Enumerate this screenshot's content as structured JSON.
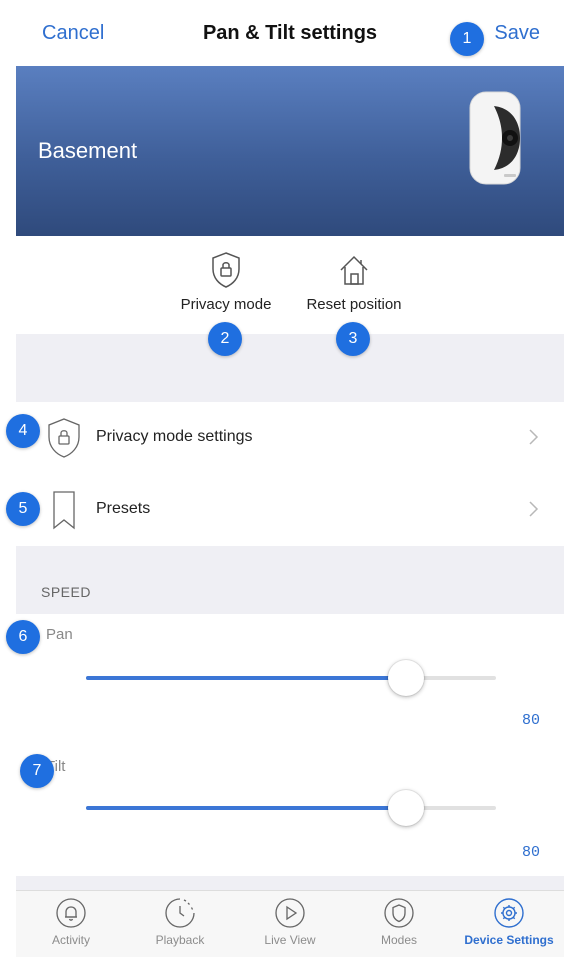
{
  "nav": {
    "cancel": "Cancel",
    "title": "Pan & Tilt settings",
    "save": "Save"
  },
  "banner": {
    "device_name": "Basement"
  },
  "actions": [
    {
      "label": "Privacy mode",
      "icon": "shield-lock-icon"
    },
    {
      "label": "Reset position",
      "icon": "home-icon"
    }
  ],
  "list": [
    {
      "label": "Privacy mode settings",
      "icon": "shield-lock-icon"
    },
    {
      "label": "Presets",
      "icon": "bookmark-icon"
    }
  ],
  "speed": {
    "header": "SPEED",
    "pan": {
      "label": "Pan",
      "value": "80",
      "level_percent": 78
    },
    "tilt": {
      "label": "Tilt",
      "value": "80",
      "level_percent": 78
    }
  },
  "tabs": [
    {
      "label": "Activity",
      "icon": "bell-icon",
      "active": false
    },
    {
      "label": "Playback",
      "icon": "clock-icon",
      "active": false
    },
    {
      "label": "Live View",
      "icon": "play-icon",
      "active": false
    },
    {
      "label": "Modes",
      "icon": "shield-icon",
      "active": false
    },
    {
      "label": "Device Settings",
      "icon": "gear-icon",
      "active": true
    }
  ],
  "callouts": [
    "1",
    "2",
    "3",
    "4",
    "5",
    "6",
    "7"
  ],
  "colors": {
    "accent": "#2f6fcf",
    "badge": "#1f6fe0",
    "banner_top": "#5a7fc0",
    "banner_bottom": "#2f4a7c"
  }
}
